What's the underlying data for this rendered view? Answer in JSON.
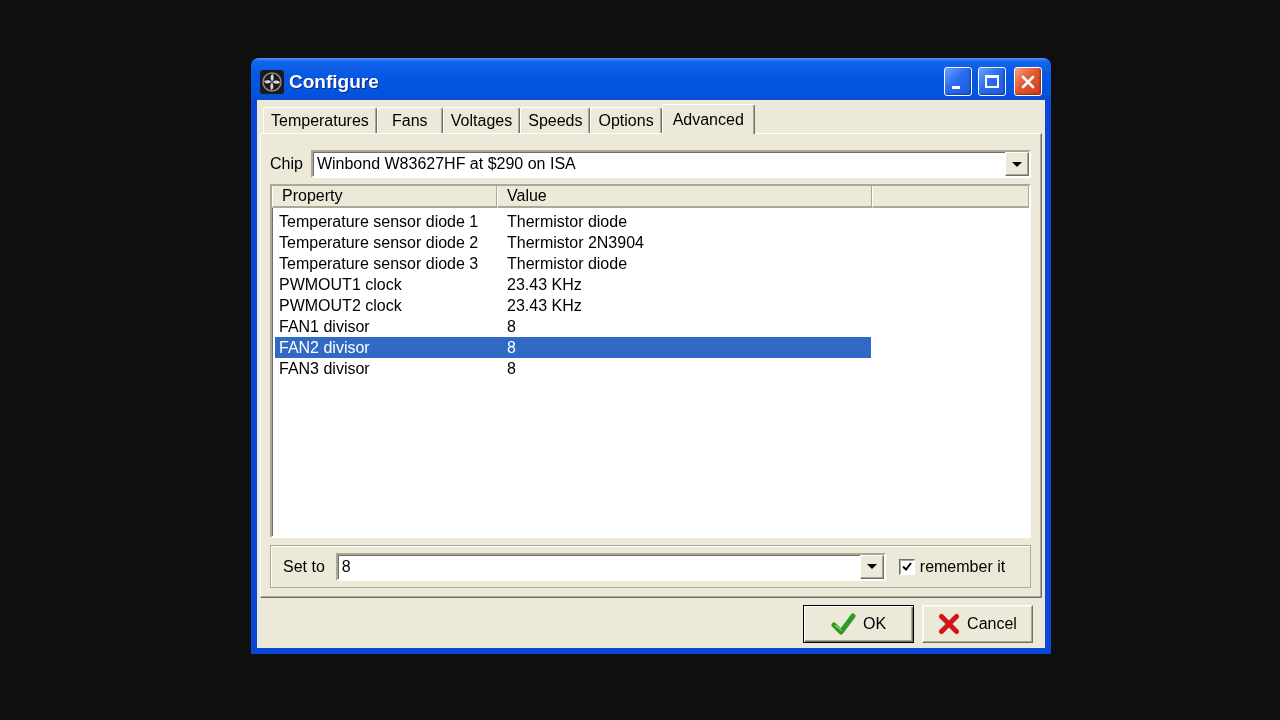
{
  "window": {
    "title": "Configure"
  },
  "tabs": [
    {
      "label": "Temperatures",
      "selected": false
    },
    {
      "label": "Fans",
      "selected": false
    },
    {
      "label": "Voltages",
      "selected": false
    },
    {
      "label": "Speeds",
      "selected": false
    },
    {
      "label": "Options",
      "selected": false
    },
    {
      "label": "Advanced",
      "selected": true
    }
  ],
  "chip": {
    "label": "Chip",
    "value": "Winbond W83627HF at $290 on ISA"
  },
  "table": {
    "columns": [
      "Property",
      "Value"
    ],
    "rows": [
      {
        "cells": [
          "Temperature sensor diode 1",
          "Thermistor diode"
        ],
        "selected": false
      },
      {
        "cells": [
          "Temperature sensor diode 2",
          "Thermistor 2N3904"
        ],
        "selected": false
      },
      {
        "cells": [
          "Temperature sensor diode 3",
          "Thermistor diode"
        ],
        "selected": false
      },
      {
        "cells": [
          "PWMOUT1 clock",
          "23.43 KHz"
        ],
        "selected": false
      },
      {
        "cells": [
          "PWMOUT2 clock",
          "23.43 KHz"
        ],
        "selected": false
      },
      {
        "cells": [
          "FAN1 divisor",
          "8"
        ],
        "selected": false
      },
      {
        "cells": [
          "FAN2 divisor",
          "8"
        ],
        "selected": true
      },
      {
        "cells": [
          "FAN3 divisor",
          "8"
        ],
        "selected": false
      }
    ]
  },
  "set_value": {
    "label": "Set to",
    "value": "8",
    "remember": {
      "label": "remember it",
      "checked": true
    }
  },
  "buttons": [
    {
      "label": "OK",
      "kind": "ok",
      "default": true
    },
    {
      "label": "Cancel",
      "kind": "cancel",
      "default": false
    }
  ]
}
